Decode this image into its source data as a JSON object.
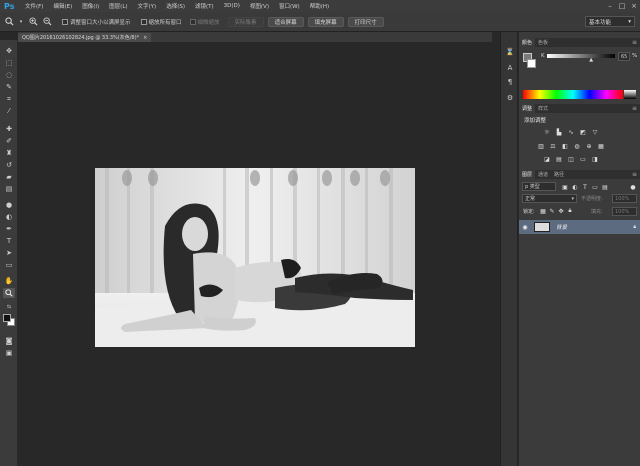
{
  "app": {
    "logo": "Ps",
    "minimize": "–",
    "maximize": "□",
    "close": "×"
  },
  "menu": [
    "文件(F)",
    "编辑(E)",
    "图像(I)",
    "图层(L)",
    "文字(Y)",
    "选择(S)",
    "滤镜(T)",
    "3D(D)",
    "视图(V)",
    "窗口(W)",
    "帮助(H)"
  ],
  "options": {
    "resize_windows_label": "调整窗口大小以满屏显示",
    "zoom_all_label": "缩放所有窗口",
    "scrubby_zoom_label": "细微缩放",
    "actual_pixels": "实际像素",
    "fit_screen": "适合屏幕",
    "fill_screen": "填充屏幕",
    "print_size": "打印尺寸",
    "workspace": "基本功能"
  },
  "document": {
    "tab_title": "QQ图片20161026102824.jpg @ 33.3%(灰色/8)*",
    "close": "×"
  },
  "color_panel": {
    "tabs": [
      "颜色",
      "色板"
    ],
    "channel_label": "K",
    "value": "65",
    "unit": "%",
    "k_percent": 65
  },
  "adjustments_panel": {
    "tabs": [
      "调整",
      "样式"
    ],
    "heading": "添加调整"
  },
  "layers_panel": {
    "tabs": [
      "图层",
      "通道",
      "路径"
    ],
    "kind_filter": "p 类型",
    "blend_mode": "正常",
    "opacity_label": "不透明度:",
    "opacity_value": "100%",
    "lock_label": "锁定:",
    "fill_label": "填充:",
    "fill_value": "100%",
    "layer_name": "背景"
  }
}
